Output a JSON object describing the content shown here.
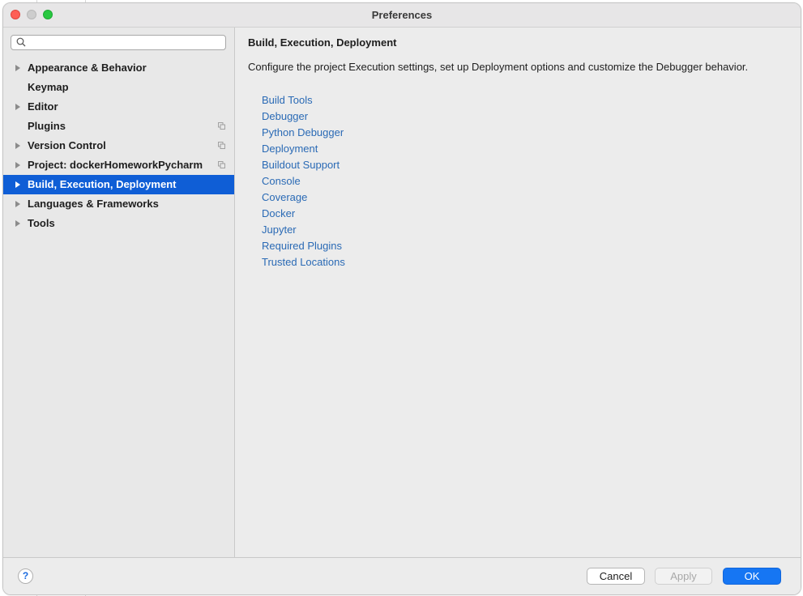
{
  "window": {
    "title": "Preferences"
  },
  "search": {
    "placeholder": ""
  },
  "sidebar": {
    "items": [
      {
        "label": "Appearance & Behavior",
        "expandable": true,
        "copy_icon": false
      },
      {
        "label": "Keymap",
        "expandable": false,
        "copy_icon": false
      },
      {
        "label": "Editor",
        "expandable": true,
        "copy_icon": false
      },
      {
        "label": "Plugins",
        "expandable": false,
        "copy_icon": true
      },
      {
        "label": "Version Control",
        "expandable": true,
        "copy_icon": true
      },
      {
        "label": "Project: dockerHomeworkPycharm",
        "expandable": true,
        "copy_icon": true
      },
      {
        "label": "Build, Execution, Deployment",
        "expandable": true,
        "copy_icon": false,
        "selected": true
      },
      {
        "label": "Languages & Frameworks",
        "expandable": true,
        "copy_icon": false
      },
      {
        "label": "Tools",
        "expandable": true,
        "copy_icon": false
      }
    ]
  },
  "content": {
    "heading": "Build, Execution, Deployment",
    "description": "Configure the project Execution settings, set up Deployment options and customize the Debugger behavior.",
    "links": [
      "Build Tools",
      "Debugger",
      "Python Debugger",
      "Deployment",
      "Buildout Support",
      "Console",
      "Coverage",
      "Docker",
      "Jupyter",
      "Required Plugins",
      "Trusted Locations"
    ]
  },
  "footer": {
    "help_label": "?",
    "cancel_label": "Cancel",
    "apply_label": "Apply",
    "ok_label": "OK"
  },
  "colors": {
    "selection": "#0f5ed6",
    "link": "#2a6ab5",
    "ok_button": "#1676f3"
  },
  "icons": {
    "search": "search-icon",
    "expand": "chevron-right-icon",
    "copy": "copy-icon",
    "help": "help-icon"
  }
}
